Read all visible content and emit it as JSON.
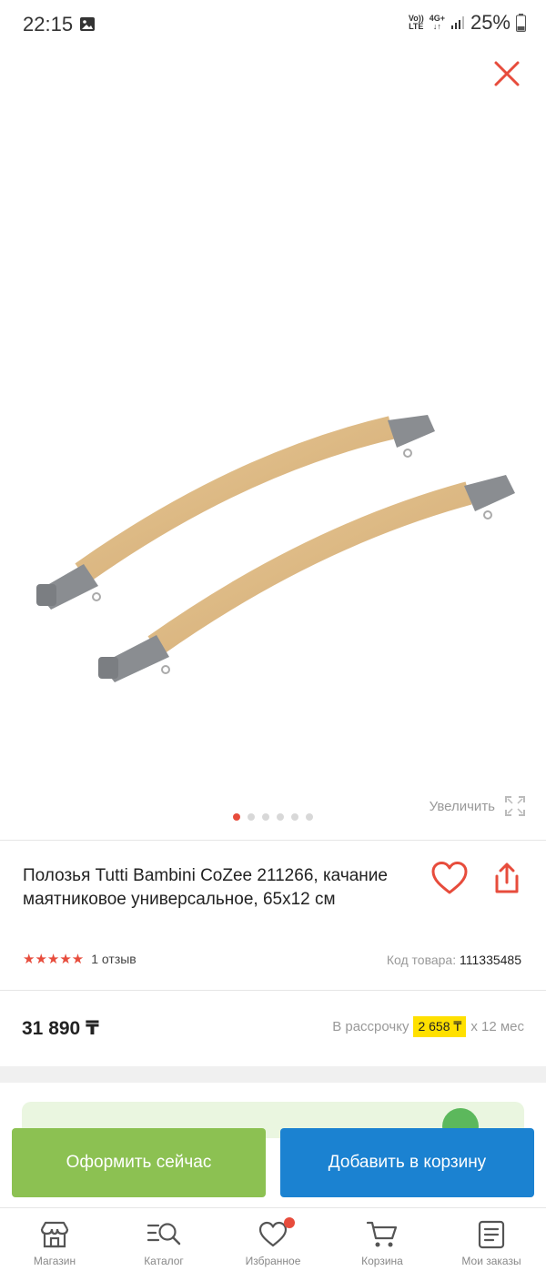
{
  "status_bar": {
    "time": "22:15",
    "network_top": "Vo))",
    "network_bottom": "LTE",
    "data_top": "4G+",
    "battery": "25%"
  },
  "gallery": {
    "zoom_label": "Увеличить",
    "dots_total": 6,
    "active_dot": 1
  },
  "product": {
    "title": "Полозья Tutti Bambini CoZee 211266, качание маятниковое универсальное, 65x12 см",
    "rating_stars": 5,
    "reviews_label": "1 отзыв",
    "sku_label": "Код товара:",
    "sku_value": "111335485",
    "price": "31 890 ₸",
    "installment_label": "В рассрочку",
    "installment_amount": "2 658 ₸",
    "installment_term": "x 12 мес"
  },
  "actions": {
    "buy_now": "Оформить сейчас",
    "add_to_cart": "Добавить в корзину"
  },
  "bottom_nav": {
    "items": [
      {
        "label": "Магазин",
        "icon": "store-icon"
      },
      {
        "label": "Каталог",
        "icon": "catalog-search-icon"
      },
      {
        "label": "Избранное",
        "icon": "heart-icon"
      },
      {
        "label": "Корзина",
        "icon": "cart-icon"
      },
      {
        "label": "Мои заказы",
        "icon": "orders-icon"
      }
    ]
  },
  "colors": {
    "accent_red": "#e74c3c",
    "buy_green": "#8cc152",
    "cart_blue": "#1b82d1",
    "installment_yellow": "#ffe000"
  }
}
